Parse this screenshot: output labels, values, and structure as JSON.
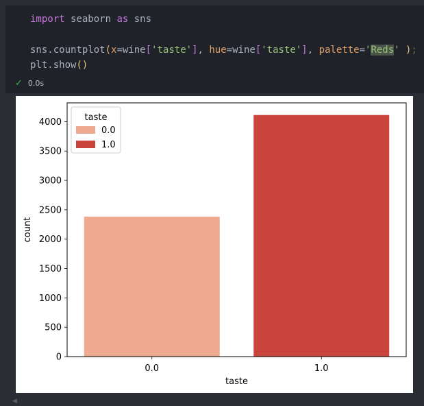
{
  "code": {
    "line1": {
      "kw1": "import",
      "mod": " seaborn ",
      "kw2": "as",
      "alias": " sns"
    },
    "line3": {
      "call": "sns.countplot",
      "open": "(",
      "p1": "x",
      "eq1": "=wine",
      "ob1": "[",
      "s1": "'taste'",
      "cb1": "]",
      "comma1": ", ",
      "p2": "hue",
      "eq2": "=wine",
      "ob2": "[",
      "s2": "'taste'",
      "cb2": "]",
      "comma2": ", ",
      "p3": "palette",
      "eq3": "=",
      "q1": "'",
      "s3": "Reds",
      "q2": "'",
      "sp": " ",
      "close": ")",
      "semi": ";"
    },
    "line4": {
      "call": "plt.show",
      "parens": "()"
    }
  },
  "status": {
    "icon": "check-icon",
    "time": "0.0s"
  },
  "chart_data": {
    "type": "bar",
    "categories": [
      "0.0",
      "1.0"
    ],
    "values": [
      2384,
      4113
    ],
    "colors": [
      "#eea991",
      "#cb443c"
    ],
    "title": "",
    "xlabel": "taste",
    "ylabel": "count",
    "ylim": [
      0,
      4320
    ],
    "yticks": [
      0,
      500,
      1000,
      1500,
      2000,
      2500,
      3000,
      3500,
      4000
    ],
    "legend": {
      "title": "taste",
      "placement": "top-left",
      "entries": [
        {
          "label": "0.0",
          "color": "#eea991"
        },
        {
          "label": "1.0",
          "color": "#cb443c"
        }
      ]
    },
    "grid": false
  }
}
